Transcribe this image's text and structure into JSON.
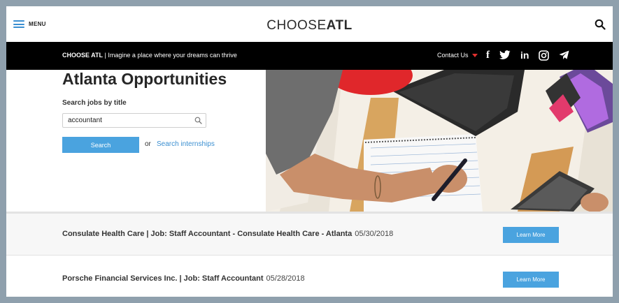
{
  "header": {
    "menu_label": "MENU",
    "logo_light": "CHOOSE",
    "logo_bold": "ATL"
  },
  "blackbar": {
    "brand": "CHOOSE ATL",
    "separator": " | ",
    "tagline": "Imagine a place where your dreams can thrive",
    "contact_label": "Contact Us",
    "social_icons": [
      "facebook-icon",
      "twitter-icon",
      "linkedin-icon",
      "instagram-icon",
      "telegram-icon"
    ]
  },
  "hero": {
    "title": "Atlanta Opportunities",
    "search_label": "Search jobs by title",
    "search_value": "accountant",
    "search_button": "Search",
    "or_text": "or",
    "internships_link": "Search internships"
  },
  "jobs": [
    {
      "title": "Consulate Health Care | Job: Staff Accountant - Consulate Health Care - Atlanta",
      "date": "05/30/2018",
      "button": "Learn More"
    },
    {
      "title": "Porsche Financial Services Inc. | Job: Staff Accountant",
      "date": "05/28/2018",
      "button": "Learn More"
    }
  ],
  "colors": {
    "accent": "#4aa3df",
    "contact_caret": "#e0302e",
    "bar": "#000000"
  }
}
